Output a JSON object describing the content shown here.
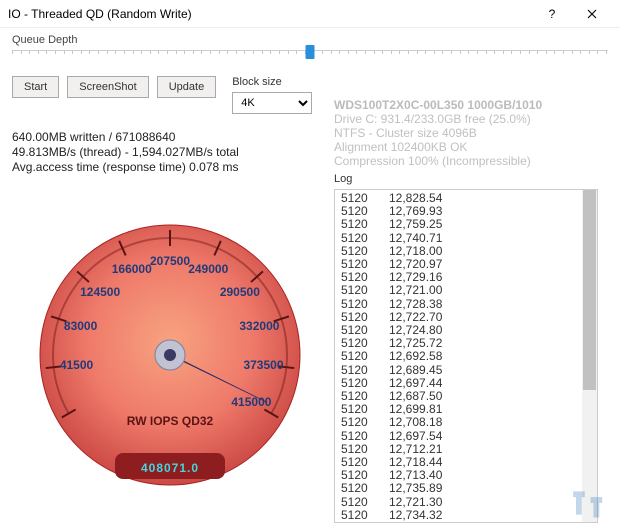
{
  "window": {
    "title": "IO - Threaded QD (Random Write)",
    "help": "?",
    "close": "×"
  },
  "slider": {
    "label": "Queue Depth"
  },
  "buttons": {
    "start": "Start",
    "screenshot": "ScreenShot",
    "update": "Update"
  },
  "blocksize": {
    "label": "Block size",
    "value": "4K"
  },
  "driveinfo": {
    "model": "WDS100T2X0C-00L350 1000GB/1010",
    "line1": "Drive C: 931.4/233.0GB free (25.0%)",
    "line2": "NTFS - Cluster size 4096B",
    "line3": "Alignment 102400KB OK",
    "line4": "Compression 100% (Incompressible)"
  },
  "stats": {
    "line1": "640.00MB written / 671088640",
    "line2": "49.813MB/s (thread) - 1,594.027MB/s total",
    "line3": "Avg.access time (response time) 0.078 ms"
  },
  "gauge": {
    "title": "RW IOPS QD32",
    "readout": "408071.0",
    "ticks": [
      "41500",
      "83000",
      "124500",
      "166000",
      "207500",
      "249000",
      "290500",
      "332000",
      "373500",
      "415000"
    ]
  },
  "log": {
    "label": "Log",
    "entries": [
      {
        "a": "5120",
        "b": "12,828.54"
      },
      {
        "a": "5120",
        "b": "12,769.93"
      },
      {
        "a": "5120",
        "b": "12,759.25"
      },
      {
        "a": "5120",
        "b": "12,740.71"
      },
      {
        "a": "5120",
        "b": "12,718.00"
      },
      {
        "a": "5120",
        "b": "12,720.97"
      },
      {
        "a": "5120",
        "b": "12,729.16"
      },
      {
        "a": "5120",
        "b": "12,721.00"
      },
      {
        "a": "5120",
        "b": "12,728.38"
      },
      {
        "a": "5120",
        "b": "12,722.70"
      },
      {
        "a": "5120",
        "b": "12,724.80"
      },
      {
        "a": "5120",
        "b": "12,725.72"
      },
      {
        "a": "5120",
        "b": "12,692.58"
      },
      {
        "a": "5120",
        "b": "12,689.45"
      },
      {
        "a": "5120",
        "b": "12,697.44"
      },
      {
        "a": "5120",
        "b": "12,687.50"
      },
      {
        "a": "5120",
        "b": "12,699.81"
      },
      {
        "a": "5120",
        "b": "12,708.18"
      },
      {
        "a": "5120",
        "b": "12,697.54"
      },
      {
        "a": "5120",
        "b": "12,712.21"
      },
      {
        "a": "5120",
        "b": "12,718.44"
      },
      {
        "a": "5120",
        "b": "12,713.40"
      },
      {
        "a": "5120",
        "b": "12,735.89"
      },
      {
        "a": "5120",
        "b": "12,721.30"
      },
      {
        "a": "5120",
        "b": "12,734.32"
      }
    ]
  },
  "chart_data": {
    "type": "gauge",
    "title": "RW IOPS QD32",
    "min": 0,
    "max": 415000,
    "value": 408071.0,
    "tick_values": [
      41500,
      83000,
      124500,
      166000,
      207500,
      249000,
      290500,
      332000,
      373500,
      415000
    ],
    "units": "IOPS"
  }
}
